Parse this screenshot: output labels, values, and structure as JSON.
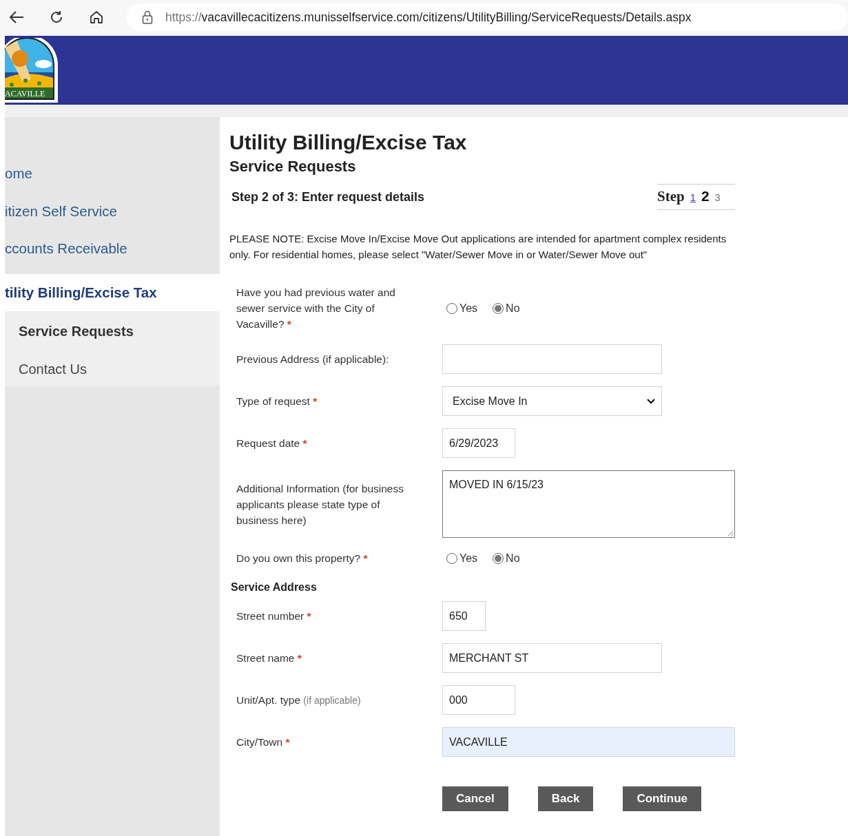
{
  "browser": {
    "url_scheme": "https://",
    "url_path": "vacavillecacitizens.munisselfservice.com/citizens/UtilityBilling/ServiceRequests/Details.aspx"
  },
  "header": {
    "logo_text": "ACAVILLE"
  },
  "sidebar": {
    "items": [
      {
        "label": "ome",
        "selected": false
      },
      {
        "label": "itizen Self Service",
        "selected": false
      },
      {
        "label": "ccounts Receivable",
        "selected": false
      },
      {
        "label": "tility Billing/Excise Tax",
        "selected": true,
        "children": [
          {
            "label": "Service Requests",
            "selected": true
          },
          {
            "label": "Contact Us",
            "selected": false
          }
        ]
      }
    ]
  },
  "page": {
    "title": "Utility Billing/Excise Tax",
    "subtitle": "Service Requests"
  },
  "step": {
    "heading": "Step 2 of 3: Enter request details",
    "label": "Step",
    "steps": [
      {
        "label": "1",
        "kind": "link"
      },
      {
        "label": "2",
        "kind": "current"
      },
      {
        "label": "3",
        "kind": "future"
      }
    ]
  },
  "note": "PLEASE NOTE: Excise Move In/Excise Move Out applications are intended for apartment complex residents only. For residential homes, please select \"Water/Sewer Move in or Water/Sewer Move out\"",
  "fields": [
    {
      "kind": "radio",
      "label": "Have you had previous water and sewer service with the City of Vacaville?",
      "required_mark": "*",
      "options": [
        {
          "label": "Yes",
          "selected": false
        },
        {
          "label": "No",
          "selected": true
        }
      ]
    },
    {
      "kind": "text",
      "label": "Previous Address (if applicable):"
    },
    {
      "kind": "select",
      "label": "Type of request",
      "required_mark": "*",
      "value": "Excise Move In"
    },
    {
      "kind": "text",
      "label": "Request date",
      "required_mark": "*",
      "value": "6/29/2023"
    },
    {
      "kind": "textarea",
      "label": "Additional Information (for business applicants please state type of business here)",
      "value": "MOVED IN 6/15/23"
    },
    {
      "kind": "radio",
      "label": "Do you own this property?",
      "required_mark": "*",
      "options": [
        {
          "label": "Yes",
          "selected": false
        },
        {
          "label": "No",
          "selected": true
        }
      ]
    },
    {
      "kind": "section",
      "label": "Service Address"
    },
    {
      "kind": "text",
      "label": "Street number",
      "required_mark": "*",
      "value": "650"
    },
    {
      "kind": "text",
      "label": "Street name",
      "required_mark": "*",
      "value": "MERCHANT ST"
    },
    {
      "kind": "text",
      "label": "Unit/Apt. type",
      "hint": "(if applicable)",
      "value": "000"
    },
    {
      "kind": "text",
      "label": "City/Town",
      "required_mark": "*",
      "value": "VACAVILLE",
      "autofilled": true
    }
  ],
  "buttons": [
    "Cancel",
    "Back",
    "Continue"
  ]
}
